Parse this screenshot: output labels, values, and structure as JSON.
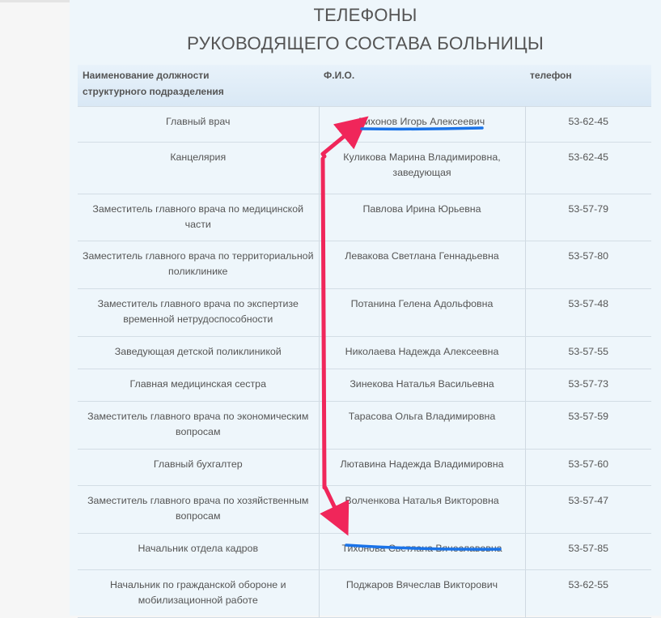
{
  "heading": {
    "line1": "ТЕЛЕФОНЫ",
    "line2": "РУКОВОДЯЩЕГО СОСТАВА БОЛЬНИЦЫ"
  },
  "table": {
    "headers": {
      "position_line1": "Наименование должности",
      "position_line2": "структурного подразделения",
      "name": "Ф.И.О.",
      "phone": "телефон"
    },
    "rows": [
      {
        "position": "Главный врач",
        "name": "Тихонов Игорь Алексеевич",
        "phone": "53-62-45"
      },
      {
        "position": "Канцелярия",
        "name": "Куликова Марина Владимировна, заведующая",
        "phone": "53-62-45"
      },
      {
        "position": "Заместитель главного врача по медицинской части",
        "name": "Павлова Ирина Юрьевна",
        "phone": "53-57-79"
      },
      {
        "position": "Заместитель главного врача по территориальной поликлинике",
        "name": "Левакова Светлана Геннадьевна",
        "phone": "53-57-80"
      },
      {
        "position": "Заместитель главного врача по экспертизе временной нетрудоспособности",
        "name": "Потанина Гелена Адольфовна",
        "phone": "53-57-48"
      },
      {
        "position": "Заведующая детской поликлиникой",
        "name": "Николаева Надежда Алексеевна",
        "phone": "53-57-55"
      },
      {
        "position": "Главная медицинская сестра",
        "name": "Зинекова Наталья Васильевна",
        "phone": "53-57-73"
      },
      {
        "position": "Заместитель главного врача по экономическим вопросам",
        "name": "Тарасова Ольга Владимировна",
        "phone": "53-57-59"
      },
      {
        "position": "Главный бухгалтер",
        "name": "Лютавина Надежда Владимировна",
        "phone": "53-57-60"
      },
      {
        "position": "Заместитель главного врача по хозяйственным вопросам",
        "name": "Волченкова Наталья Викторовна",
        "phone": "53-57-47"
      },
      {
        "position": "Начальник отдела кадров",
        "name": "Тихонова Светлана Вячеславовна",
        "phone": "53-57-85"
      },
      {
        "position": "Начальник по гражданской обороне и мобилизационной работе",
        "name": "Поджаров Вячеслав Викторович",
        "phone": "53-62-55"
      }
    ]
  },
  "annotations": {
    "arrow_color": "#f0265a",
    "underline_color": "#1a73e8"
  }
}
